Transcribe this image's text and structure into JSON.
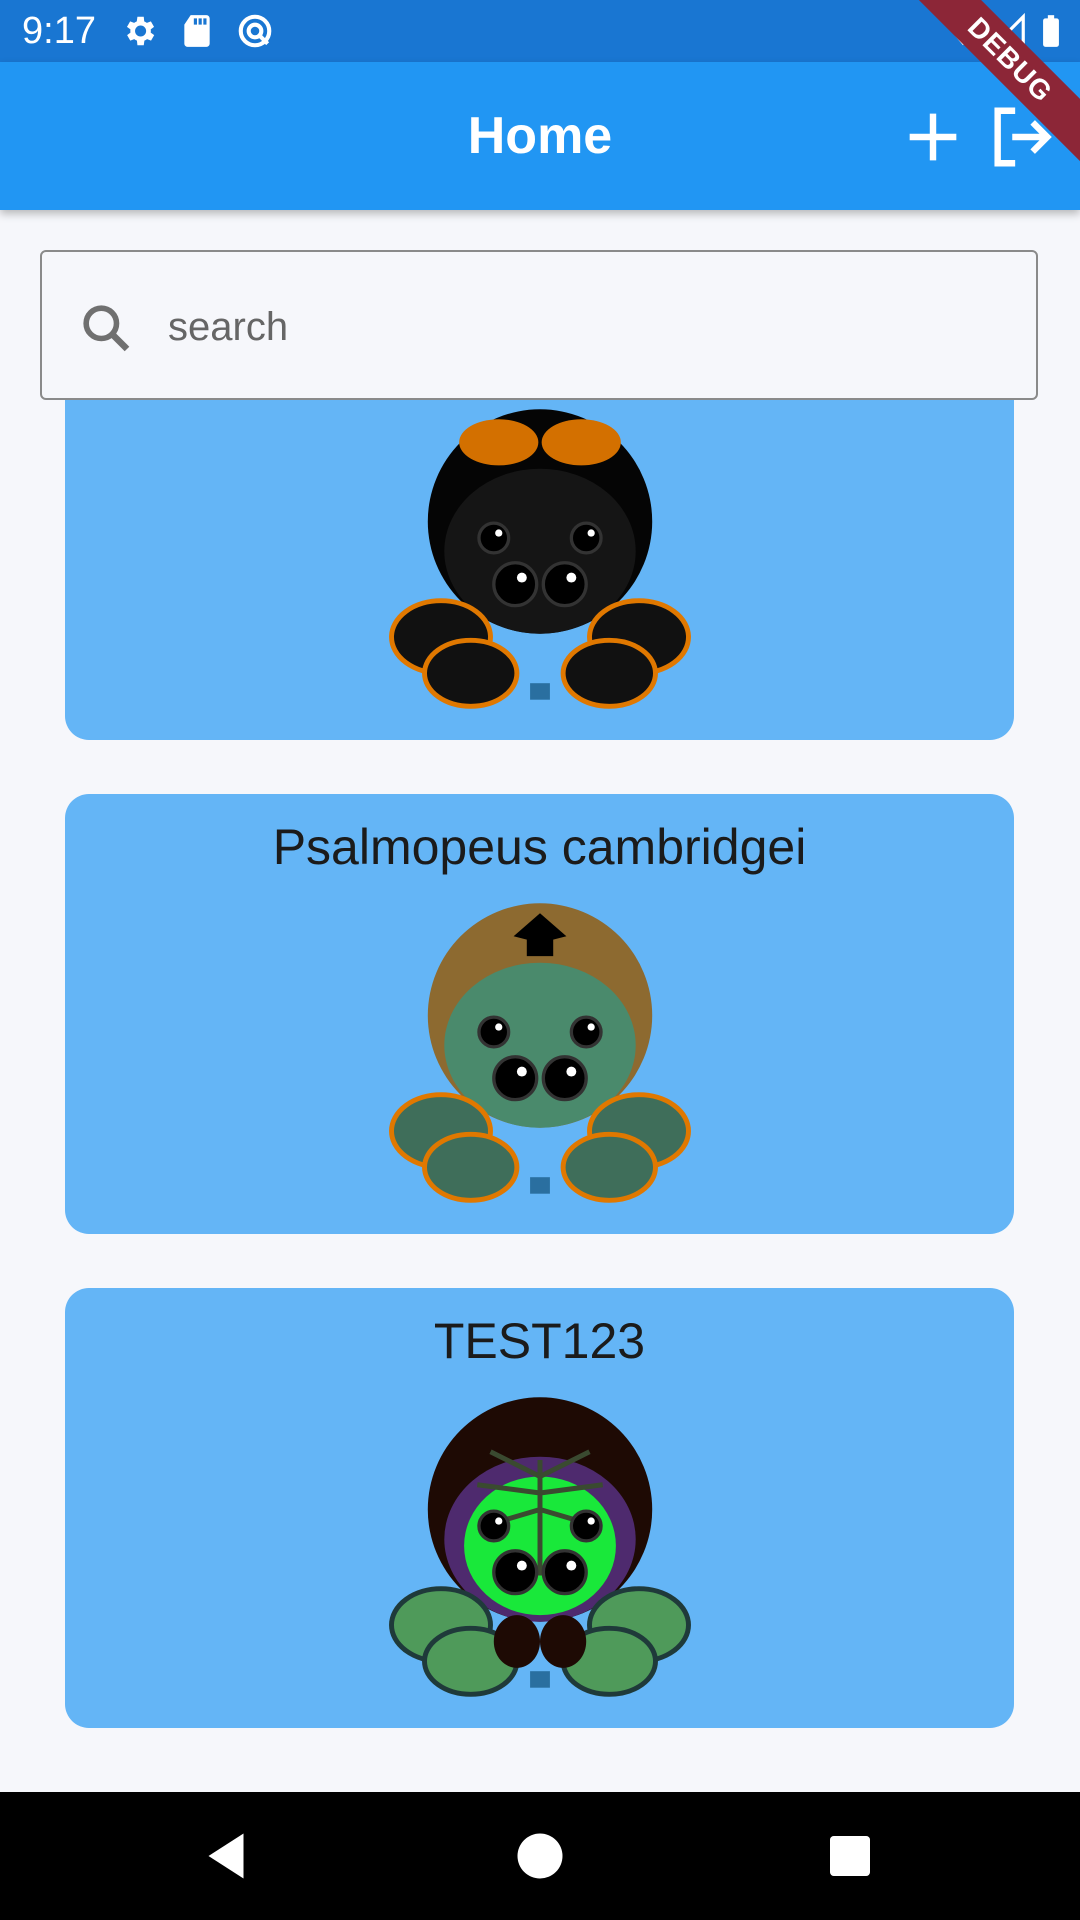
{
  "status_bar": {
    "time": "9:17",
    "icons": [
      "gear-icon",
      "sd-card-icon",
      "sync-icon",
      "wifi-icon",
      "signal-icon",
      "battery-icon"
    ]
  },
  "debug_banner": "DEBUG",
  "app_bar": {
    "title": "Home",
    "actions": [
      "add-icon",
      "logout-icon"
    ],
    "color": "#2196f3"
  },
  "search": {
    "placeholder": "search",
    "value": ""
  },
  "cards": [
    {
      "name": "",
      "avatar": "black-orange-spider"
    },
    {
      "name": "Psalmopeus cambridgei",
      "avatar": "brown-green-spider"
    },
    {
      "name": "TEST123",
      "avatar": "purple-green-spider"
    }
  ],
  "colors": {
    "card": "#64b5f6",
    "status_bar": "#1976d2",
    "background": "#f6f7fb"
  },
  "nav_bar": [
    "back-icon",
    "home-icon",
    "recents-icon"
  ]
}
